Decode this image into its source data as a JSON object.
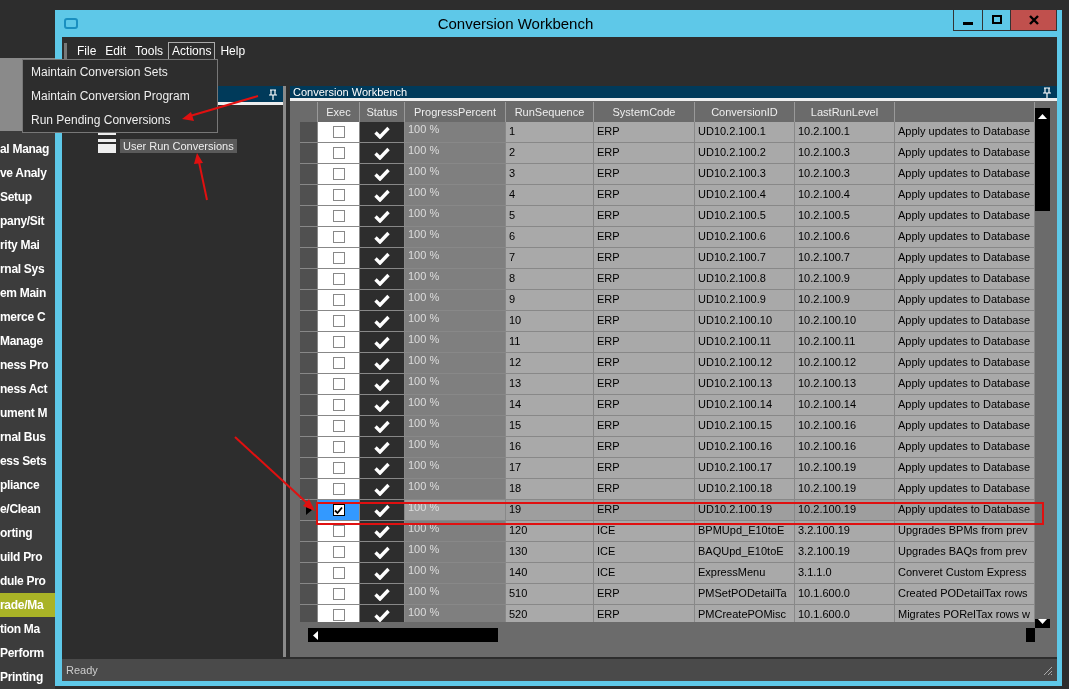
{
  "background_menu": [
    {
      "label": "al Manag",
      "selected": false
    },
    {
      "label": "ve Analy",
      "selected": false
    },
    {
      "label": "Setup",
      "selected": false
    },
    {
      "label": "pany/Sit",
      "selected": false
    },
    {
      "label": "rity Mai",
      "selected": false
    },
    {
      "label": "rnal Sys",
      "selected": false
    },
    {
      "label": "em Main",
      "selected": false
    },
    {
      "label": "merce C",
      "selected": false
    },
    {
      "label": "Manage",
      "selected": false
    },
    {
      "label": "ness Pro",
      "selected": false
    },
    {
      "label": "ness Act",
      "selected": false
    },
    {
      "label": "ument M",
      "selected": false
    },
    {
      "label": "rnal Bus",
      "selected": false
    },
    {
      "label": "ess Sets",
      "selected": false
    },
    {
      "label": "pliance",
      "selected": false
    },
    {
      "label": "e/Clean",
      "selected": false
    },
    {
      "label": "orting",
      "selected": false
    },
    {
      "label": "uild Pro",
      "selected": false
    },
    {
      "label": "dule Pro",
      "selected": false
    },
    {
      "label": "rade/Ma",
      "selected": true
    },
    {
      "label": "tion Ma",
      "selected": false
    },
    {
      "label": "Perform",
      "selected": false
    },
    {
      "label": "Printing",
      "selected": false
    }
  ],
  "window": {
    "title": "Conversion Workbench"
  },
  "menubar": [
    {
      "label": "File",
      "selected": false
    },
    {
      "label": "Edit",
      "selected": false
    },
    {
      "label": "Tools",
      "selected": false
    },
    {
      "label": "Actions",
      "selected": true
    },
    {
      "label": "Help",
      "selected": false
    }
  ],
  "open_menu": {
    "items": [
      {
        "label": "Maintain Conversion Sets"
      },
      {
        "label": "Maintain Conversion Program"
      },
      {
        "label": "Run Pending Conversions"
      }
    ]
  },
  "tree": {
    "items": [
      {
        "label": "User Run Conversions",
        "selected": true
      }
    ]
  },
  "grid_panel": {
    "title": "Conversion Workbench"
  },
  "columns": [
    "Exec",
    "Status",
    "ProgressPercent",
    "RunSequence",
    "SystemCode",
    "ConversionID",
    "LastRunLevel"
  ],
  "rows": [
    {
      "exec": false,
      "done": true,
      "progress": "100 %",
      "seq": "1",
      "system": "ERP",
      "id": "UD10.2.100.1",
      "level": "10.2.100.1",
      "description": "Apply updates to Database",
      "selected": false
    },
    {
      "exec": false,
      "done": true,
      "progress": "100 %",
      "seq": "2",
      "system": "ERP",
      "id": "UD10.2.100.2",
      "level": "10.2.100.3",
      "description": "Apply updates to Database",
      "selected": false
    },
    {
      "exec": false,
      "done": true,
      "progress": "100 %",
      "seq": "3",
      "system": "ERP",
      "id": "UD10.2.100.3",
      "level": "10.2.100.3",
      "description": "Apply updates to Database",
      "selected": false
    },
    {
      "exec": false,
      "done": true,
      "progress": "100 %",
      "seq": "4",
      "system": "ERP",
      "id": "UD10.2.100.4",
      "level": "10.2.100.4",
      "description": "Apply updates to Database",
      "selected": false
    },
    {
      "exec": false,
      "done": true,
      "progress": "100 %",
      "seq": "5",
      "system": "ERP",
      "id": "UD10.2.100.5",
      "level": "10.2.100.5",
      "description": "Apply updates to Database",
      "selected": false
    },
    {
      "exec": false,
      "done": true,
      "progress": "100 %",
      "seq": "6",
      "system": "ERP",
      "id": "UD10.2.100.6",
      "level": "10.2.100.6",
      "description": "Apply updates to Database",
      "selected": false
    },
    {
      "exec": false,
      "done": true,
      "progress": "100 %",
      "seq": "7",
      "system": "ERP",
      "id": "UD10.2.100.7",
      "level": "10.2.100.7",
      "description": "Apply updates to Database",
      "selected": false
    },
    {
      "exec": false,
      "done": true,
      "progress": "100 %",
      "seq": "8",
      "system": "ERP",
      "id": "UD10.2.100.8",
      "level": "10.2.100.9",
      "description": "Apply updates to Database",
      "selected": false
    },
    {
      "exec": false,
      "done": true,
      "progress": "100 %",
      "seq": "9",
      "system": "ERP",
      "id": "UD10.2.100.9",
      "level": "10.2.100.9",
      "description": "Apply updates to Database",
      "selected": false
    },
    {
      "exec": false,
      "done": true,
      "progress": "100 %",
      "seq": "10",
      "system": "ERP",
      "id": "UD10.2.100.10",
      "level": "10.2.100.10",
      "description": "Apply updates to Database",
      "selected": false
    },
    {
      "exec": false,
      "done": true,
      "progress": "100 %",
      "seq": "11",
      "system": "ERP",
      "id": "UD10.2.100.11",
      "level": "10.2.100.11",
      "description": "Apply updates to Database",
      "selected": false
    },
    {
      "exec": false,
      "done": true,
      "progress": "100 %",
      "seq": "12",
      "system": "ERP",
      "id": "UD10.2.100.12",
      "level": "10.2.100.12",
      "description": "Apply updates to Database",
      "selected": false
    },
    {
      "exec": false,
      "done": true,
      "progress": "100 %",
      "seq": "13",
      "system": "ERP",
      "id": "UD10.2.100.13",
      "level": "10.2.100.13",
      "description": "Apply updates to Database",
      "selected": false
    },
    {
      "exec": false,
      "done": true,
      "progress": "100 %",
      "seq": "14",
      "system": "ERP",
      "id": "UD10.2.100.14",
      "level": "10.2.100.14",
      "description": "Apply updates to Database",
      "selected": false
    },
    {
      "exec": false,
      "done": true,
      "progress": "100 %",
      "seq": "15",
      "system": "ERP",
      "id": "UD10.2.100.15",
      "level": "10.2.100.16",
      "description": "Apply updates to Database",
      "selected": false
    },
    {
      "exec": false,
      "done": true,
      "progress": "100 %",
      "seq": "16",
      "system": "ERP",
      "id": "UD10.2.100.16",
      "level": "10.2.100.16",
      "description": "Apply updates to Database",
      "selected": false
    },
    {
      "exec": false,
      "done": true,
      "progress": "100 %",
      "seq": "17",
      "system": "ERP",
      "id": "UD10.2.100.17",
      "level": "10.2.100.19",
      "description": "Apply updates to Database",
      "selected": false
    },
    {
      "exec": false,
      "done": true,
      "progress": "100 %",
      "seq": "18",
      "system": "ERP",
      "id": "UD10.2.100.18",
      "level": "10.2.100.19",
      "description": "Apply updates to Database",
      "selected": false
    },
    {
      "exec": true,
      "done": true,
      "progress": "100 %",
      "seq": "19",
      "system": "ERP",
      "id": "UD10.2.100.19",
      "level": "10.2.100.19",
      "description": "Apply updates to Database",
      "selected": true
    },
    {
      "exec": false,
      "done": true,
      "progress": "100 %",
      "seq": "120",
      "system": "ICE",
      "id": "BPMUpd_E10toE",
      "level": "3.2.100.19",
      "description": "Upgrades BPMs from prev",
      "selected": false
    },
    {
      "exec": false,
      "done": true,
      "progress": "100 %",
      "seq": "130",
      "system": "ICE",
      "id": "BAQUpd_E10toE",
      "level": "3.2.100.19",
      "description": "Upgrades BAQs from prev",
      "selected": false
    },
    {
      "exec": false,
      "done": true,
      "progress": "100 %",
      "seq": "140",
      "system": "ICE",
      "id": "ExpressMenu",
      "level": "3.1.1.0",
      "description": "Converet Custom Express",
      "selected": false
    },
    {
      "exec": false,
      "done": true,
      "progress": "100 %",
      "seq": "510",
      "system": "ERP",
      "id": "PMSetPODetailTa",
      "level": "10.1.600.0",
      "description": "Created PODetailTax rows",
      "selected": false
    },
    {
      "exec": false,
      "done": true,
      "progress": "100 %",
      "seq": "520",
      "system": "ERP",
      "id": "PMCreatePOMisc",
      "level": "10.1.600.0",
      "description": "Migrates PORelTax rows w",
      "selected": false
    }
  ],
  "status_bar": "Ready"
}
